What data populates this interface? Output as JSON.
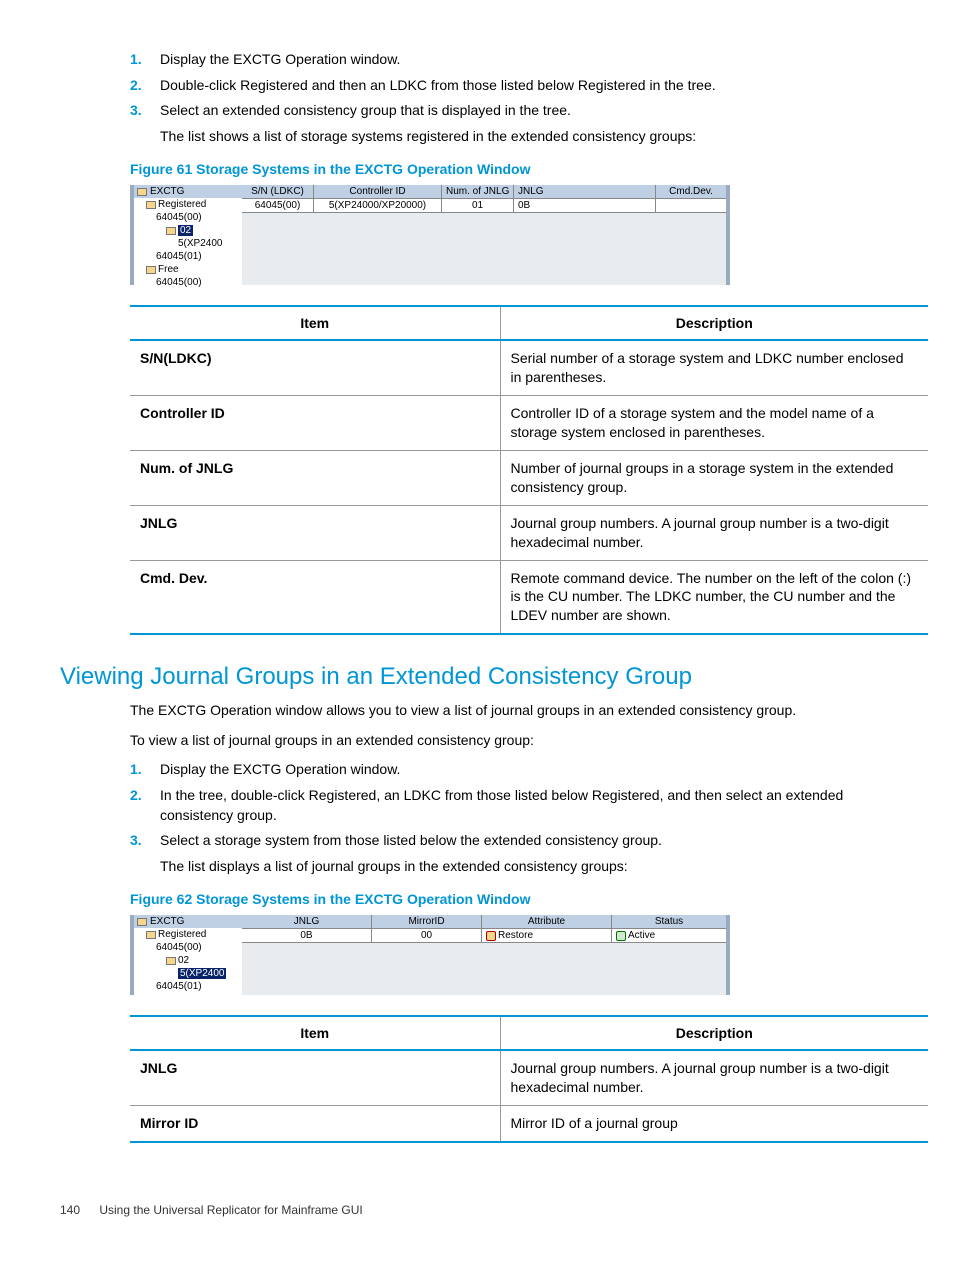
{
  "steps1": {
    "s1": "Display the EXCTG Operation window.",
    "s2": "Double-click Registered and then an LDKC from those listed below Registered in the tree.",
    "s3": "Select an extended consistency group that is displayed in the tree.",
    "after3": "The list shows a list of storage systems registered in the extended consistency groups:"
  },
  "fig61": {
    "caption": "Figure 61 Storage Systems in the EXCTG Operation Window",
    "tree": {
      "root": "EXCTG",
      "n1": "Registered",
      "n2": "64045(00)",
      "n3": "02",
      "n4": "5(XP2400",
      "n5": "64045(01)",
      "n6": "Free",
      "n7": "64045(00)"
    },
    "cols": {
      "c1": "S/N (LDKC)",
      "c2": "Controller ID",
      "c3": "Num. of JNLG",
      "c4": "JNLG",
      "c5": "Cmd.Dev."
    },
    "row": {
      "c1": "64045(00)",
      "c2": "5(XP24000/XP20000)",
      "c3": "01",
      "c4": "0B",
      "c5": ""
    }
  },
  "table1": {
    "h1": "Item",
    "h2": "Description",
    "r1k": "S/N(LDKC)",
    "r1v": "Serial number of a storage system and LDKC number enclosed in parentheses.",
    "r2k": "Controller ID",
    "r2v": "Controller ID of a storage system and the model name of a storage system enclosed in parentheses.",
    "r3k": "Num. of JNLG",
    "r3v": "Number of journal groups in a storage system in the extended consistency group.",
    "r4k": "JNLG",
    "r4v": "Journal group numbers. A journal group number is a two-digit hexadecimal number.",
    "r5k": "Cmd. Dev.",
    "r5v": "Remote command device. The number on the left of the colon (:) is the CU number. The LDKC number, the CU number and the LDEV number are shown."
  },
  "section2": {
    "title": "Viewing Journal Groups in an Extended Consistency Group",
    "p1": "The EXCTG Operation window allows you to view a list of journal groups in an extended consistency group.",
    "p2": "To view a list of journal groups in an extended consistency group:"
  },
  "steps2": {
    "s1": "Display the EXCTG Operation window.",
    "s2": "In the tree, double-click Registered, an LDKC from those listed below Registered, and then select an extended consistency group.",
    "s3": "Select a storage system from those listed below the extended consistency group.",
    "after3": "The list displays a list of journal groups in the extended consistency groups:"
  },
  "fig62": {
    "caption": "Figure 62 Storage Systems in the EXCTG Operation Window",
    "tree": {
      "root": "EXCTG",
      "n1": "Registered",
      "n2": "64045(00)",
      "n3": "02",
      "n4": "5(XP2400",
      "n5": "64045(01)"
    },
    "cols": {
      "c1": "JNLG",
      "c2": "MirrorID",
      "c3": "Attribute",
      "c4": "Status"
    },
    "row": {
      "c1": "0B",
      "c2": "00",
      "c3": "Restore",
      "c4": "Active"
    }
  },
  "table2": {
    "h1": "Item",
    "h2": "Description",
    "r1k": "JNLG",
    "r1v": "Journal group numbers. A journal group number is a two-digit hexadecimal number.",
    "r2k": "Mirror ID",
    "r2v": "Mirror ID of a journal group"
  },
  "footer": {
    "page": "140",
    "text": "Using the Universal Replicator for Mainframe GUI"
  }
}
